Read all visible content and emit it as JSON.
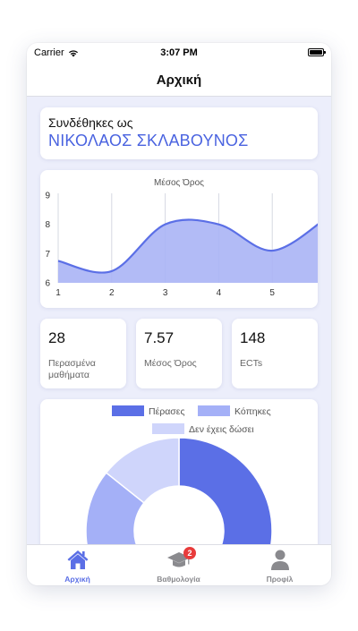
{
  "status_bar": {
    "carrier": "Carrier",
    "time": "3:07 PM"
  },
  "nav": {
    "title": "Αρχική"
  },
  "login": {
    "label": "Συνδέθηκες ως",
    "name": "ΝΙΚΟΛΑΟΣ ΣΚΛΑΒΟΥΝΟΣ"
  },
  "stats": [
    {
      "value": "28",
      "label": "Περασμένα μαθήματα"
    },
    {
      "value": "7.57",
      "label": "Μέσος Όρος"
    },
    {
      "value": "148",
      "label": "ECTs"
    }
  ],
  "tabs": [
    {
      "label": "Αρχική",
      "icon": "home-icon",
      "active": true
    },
    {
      "label": "Βαθμολογία",
      "icon": "graduation-cap-icon",
      "badge": "2"
    },
    {
      "label": "Προφίλ",
      "icon": "person-icon"
    }
  ],
  "colors": {
    "accent": "#5b6fe6",
    "line": "#5b6fe6",
    "area": "#aab4f5",
    "failed": "#a4b0f7",
    "pending": "#cfd5fb",
    "badge": "#e83b3b"
  },
  "chart_data": [
    {
      "type": "area",
      "title": "Μέσος Όρος",
      "x": [
        1,
        2,
        3,
        4,
        5,
        6
      ],
      "values": [
        6.75,
        6.4,
        8.0,
        8.0,
        7.1,
        8.2
      ],
      "xlim": [
        1,
        6
      ],
      "ylim": [
        6,
        9
      ],
      "yticks": [
        6,
        7,
        8,
        9
      ],
      "grid": "vertical"
    },
    {
      "type": "pie",
      "legend": [
        "Πέρασες",
        "Κόπηκες",
        "Δεν έχεις δώσει"
      ],
      "legend_position": "top",
      "values": [
        28,
        8,
        6
      ]
    }
  ]
}
